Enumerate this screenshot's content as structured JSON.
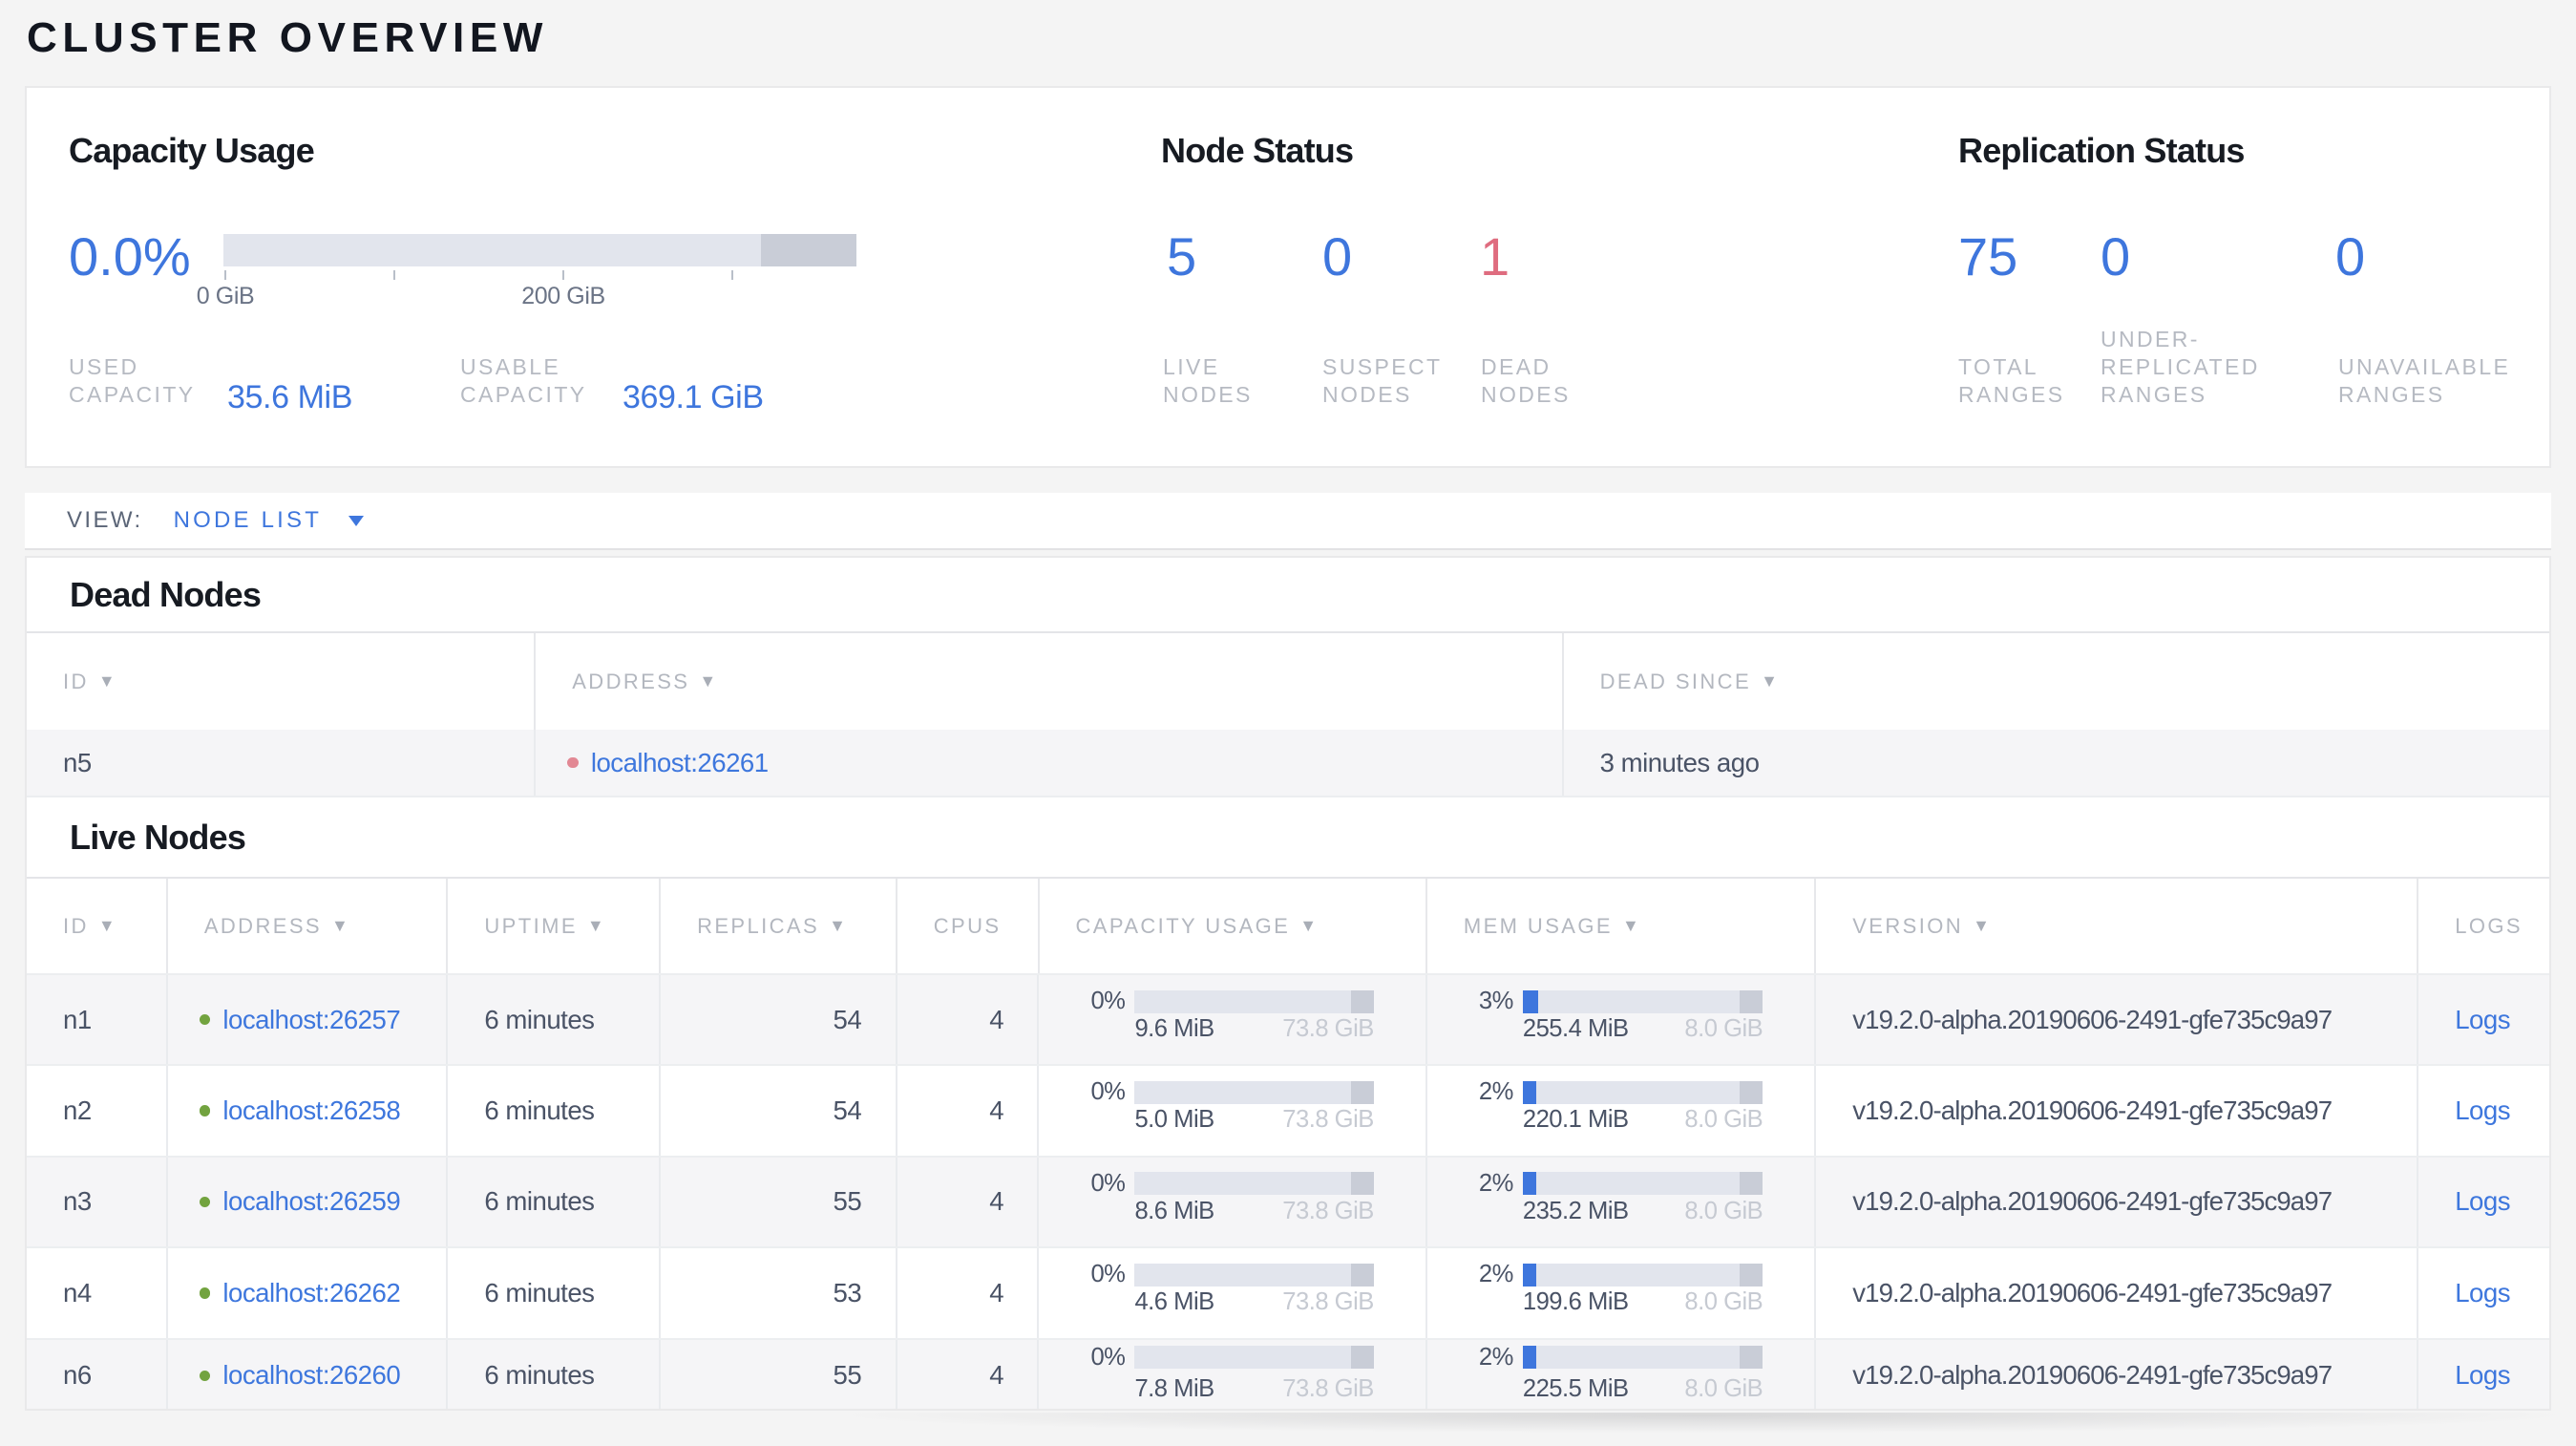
{
  "page_title": "CLUSTER OVERVIEW",
  "summary": {
    "capacity": {
      "title": "Capacity Usage",
      "percent": "0.0%",
      "tick_labels": [
        "0 GiB",
        "200 GiB"
      ],
      "used_label": "USED\nCAPACITY",
      "used_value": "35.6 MiB",
      "usable_label": "USABLE\nCAPACITY",
      "usable_value": "369.1 GiB"
    },
    "node_status": {
      "title": "Node Status",
      "items": [
        {
          "value": "5",
          "label": "LIVE\nNODES"
        },
        {
          "value": "0",
          "label": "SUSPECT\nNODES"
        },
        {
          "value": "1",
          "label": "DEAD\nNODES"
        }
      ]
    },
    "replication": {
      "title": "Replication Status",
      "items": [
        {
          "value": "75",
          "label": "TOTAL\nRANGES"
        },
        {
          "value": "0",
          "label": "UNDER-\nREPLICATED\nRANGES"
        },
        {
          "value": "0",
          "label": "UNAVAILABLE\nRANGES"
        }
      ]
    }
  },
  "view_bar": {
    "label": "VIEW:",
    "selected": "NODE LIST"
  },
  "dead_nodes": {
    "title": "Dead Nodes",
    "columns": [
      "ID",
      "ADDRESS",
      "DEAD SINCE"
    ],
    "rows": [
      {
        "id": "n5",
        "address": "localhost:26261",
        "dead_since": "3 minutes ago"
      }
    ]
  },
  "live_nodes": {
    "title": "Live Nodes",
    "columns": [
      "ID",
      "ADDRESS",
      "UPTIME",
      "REPLICAS",
      "CPUS",
      "CAPACITY USAGE",
      "MEM USAGE",
      "VERSION",
      "LOGS"
    ],
    "rows": [
      {
        "id": "n1",
        "address": "localhost:26257",
        "uptime": "6 minutes",
        "replicas": "54",
        "cpus": "4",
        "capacity_pct": "0%",
        "capacity_used": "9.6 MiB",
        "capacity_total": "73.8 GiB",
        "mem_pct": "3%",
        "mem_used": "255.4 MiB",
        "mem_total": "8.0 GiB",
        "version": "v19.2.0-alpha.20190606-2491-gfe735c9a97",
        "logs_label": "Logs"
      },
      {
        "id": "n2",
        "address": "localhost:26258",
        "uptime": "6 minutes",
        "replicas": "54",
        "cpus": "4",
        "capacity_pct": "0%",
        "capacity_used": "5.0 MiB",
        "capacity_total": "73.8 GiB",
        "mem_pct": "2%",
        "mem_used": "220.1 MiB",
        "mem_total": "8.0 GiB",
        "version": "v19.2.0-alpha.20190606-2491-gfe735c9a97",
        "logs_label": "Logs"
      },
      {
        "id": "n3",
        "address": "localhost:26259",
        "uptime": "6 minutes",
        "replicas": "55",
        "cpus": "4",
        "capacity_pct": "0%",
        "capacity_used": "8.6 MiB",
        "capacity_total": "73.8 GiB",
        "mem_pct": "2%",
        "mem_used": "235.2 MiB",
        "mem_total": "8.0 GiB",
        "version": "v19.2.0-alpha.20190606-2491-gfe735c9a97",
        "logs_label": "Logs"
      },
      {
        "id": "n4",
        "address": "localhost:26262",
        "uptime": "6 minutes",
        "replicas": "53",
        "cpus": "4",
        "capacity_pct": "0%",
        "capacity_used": "4.6 MiB",
        "capacity_total": "73.8 GiB",
        "mem_pct": "2%",
        "mem_used": "199.6 MiB",
        "mem_total": "8.0 GiB",
        "version": "v19.2.0-alpha.20190606-2491-gfe735c9a97",
        "logs_label": "Logs"
      },
      {
        "id": "n6",
        "address": "localhost:26260",
        "uptime": "6 minutes",
        "replicas": "55",
        "cpus": "4",
        "capacity_pct": "0%",
        "capacity_used": "7.8 MiB",
        "capacity_total": "73.8 GiB",
        "mem_pct": "2%",
        "mem_used": "225.5 MiB",
        "mem_total": "8.0 GiB",
        "version": "v19.2.0-alpha.20190606-2491-gfe735c9a97",
        "logs_label": "Logs"
      }
    ]
  }
}
